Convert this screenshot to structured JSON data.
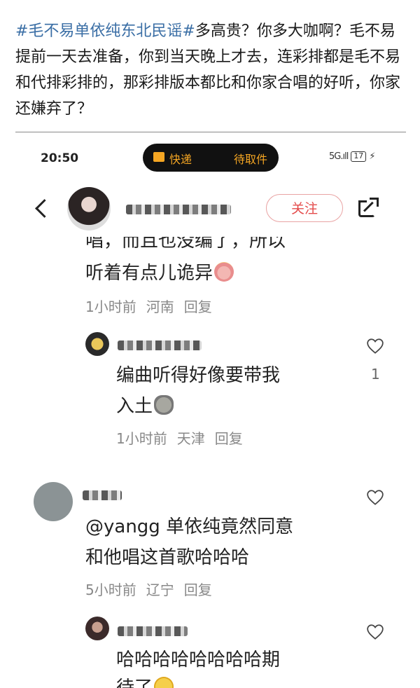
{
  "post": {
    "tag": "#毛不易单依纯东北民谣#",
    "text": "多高贵？你多大咖啊？毛不易提前一天去准备，你到当天晚上才去，连彩排都是毛不易和代排彩排的，那彩排版本都比和你家合唱的好听，你家还嫌弃了？"
  },
  "status_bar": {
    "time": "20:50",
    "pill_label_1": "快递",
    "pill_label_2": "待取件",
    "signal": "5G.ıll",
    "battery": "17"
  },
  "header": {
    "follow_label": "关注"
  },
  "comments": {
    "partial_top_line": "唱，而且也没编了，所以",
    "first_tail": "听着有点儿诡异",
    "first_meta_time": "1小时前",
    "first_meta_loc": "河南",
    "reply_label": "回复",
    "reply1_text_line1": "编曲听得好像要带我",
    "reply1_text_line2": "入土",
    "reply1_meta_time": "1小时前",
    "reply1_meta_loc": "天津",
    "reply1_likes": "1",
    "c3_text_line1": "@yangg 单依纯竟然同意",
    "c3_text_line2": "和他唱这首歌哈哈哈",
    "c3_meta_time": "5小时前",
    "c3_meta_loc": "辽宁",
    "c4_text_line1": "哈哈哈哈哈哈哈哈期",
    "c4_text_line2": "待了"
  },
  "colors": {
    "tag": "#3a6ea5",
    "follow": "#e44b4b",
    "pill_bg": "#111111",
    "pill_text": "#f5a623",
    "meta": "#888888"
  },
  "icons": [
    "back-arrow-icon",
    "share-icon",
    "heart-icon",
    "emoji-icon"
  ]
}
